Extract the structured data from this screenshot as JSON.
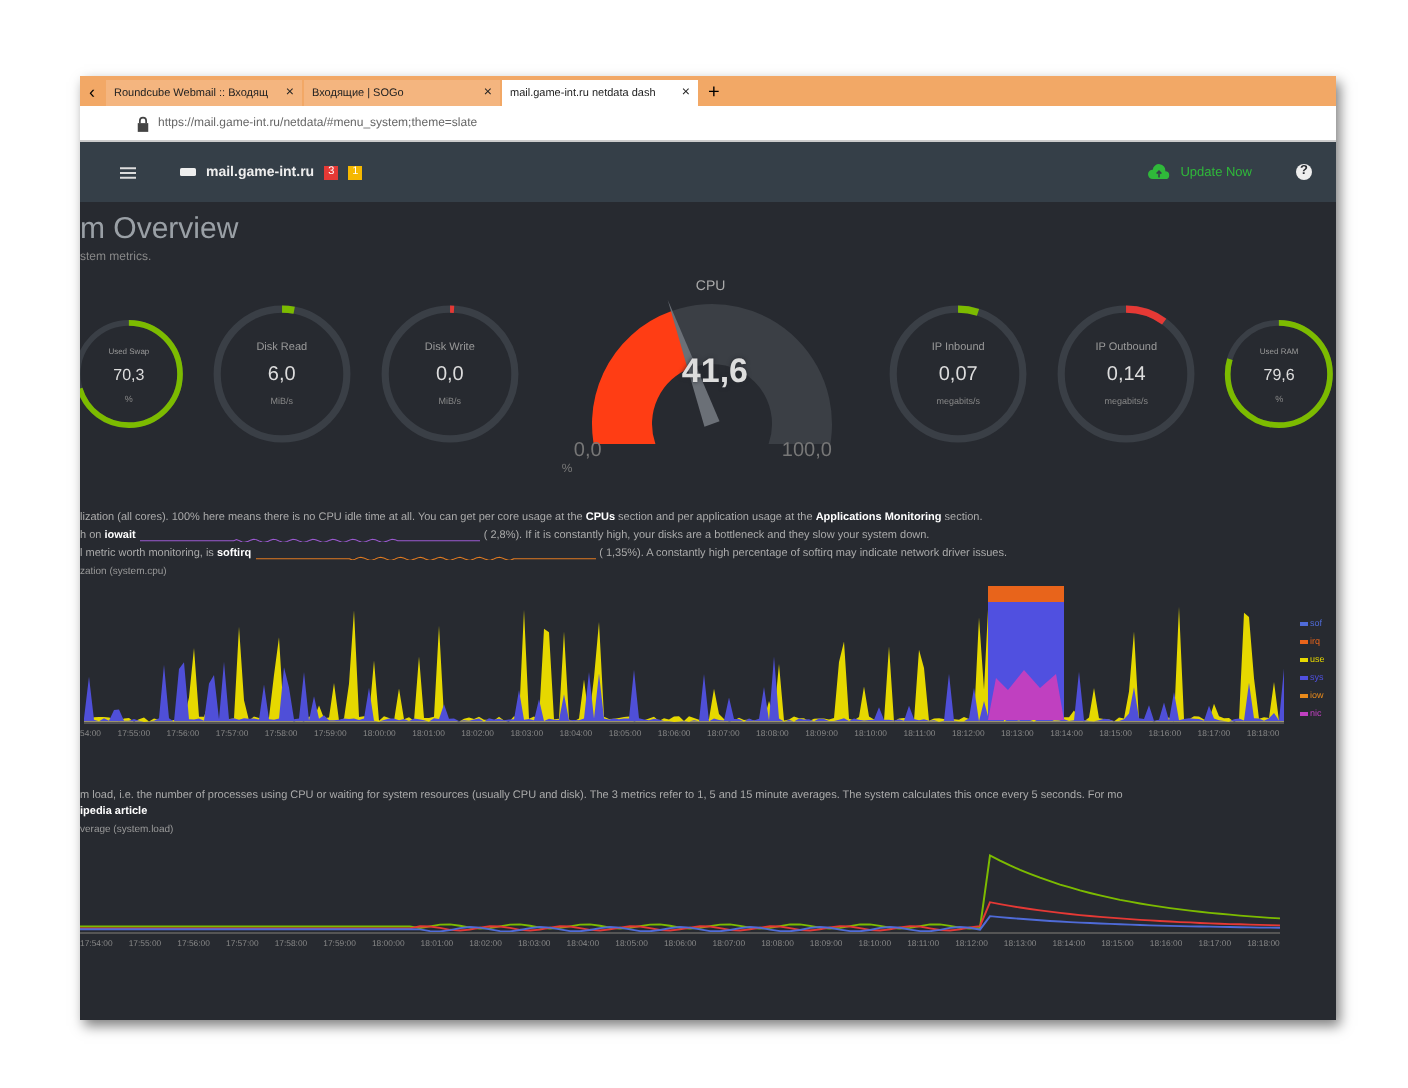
{
  "browser": {
    "scroll_left": "‹",
    "new_tab": "+",
    "tabs": [
      {
        "title": "Roundcube Webmail :: Входящ",
        "close": "×",
        "selected": false
      },
      {
        "title": "Входящие | SOGo",
        "close": "×",
        "selected": false
      },
      {
        "title": "mail.game-int.ru netdata dash",
        "close": "×",
        "selected": true
      }
    ],
    "url": "https://mail.game-int.ru/netdata/#menu_system;theme=slate"
  },
  "header": {
    "hostname": "mail.game-int.ru",
    "alarms": [
      {
        "count": "3",
        "color": "#e53935"
      },
      {
        "count": "1",
        "color": "#f5b800"
      }
    ],
    "update": "Update Now",
    "help": "?"
  },
  "page": {
    "title": "m Overview",
    "subtitle": "stem metrics."
  },
  "gauges": [
    {
      "kind": "minipie",
      "label": "Used Swap",
      "value": "70,3",
      "unit": "%",
      "level": 0.703,
      "color": "#7cbb00"
    },
    {
      "kind": "pie",
      "label": "Disk Read",
      "value": "6,0",
      "unit": "MiB/s",
      "level": 0.03,
      "color": "#7cbb00"
    },
    {
      "kind": "pie",
      "label": "Disk Write",
      "value": "0,0",
      "unit": "MiB/s",
      "level": 0.01,
      "color": "#e53935"
    },
    {
      "kind": "cpu",
      "label": "CPU",
      "value": "41,6",
      "unit": "%",
      "level": 0.416,
      "min": "0,0",
      "max": "100,0"
    },
    {
      "kind": "pie",
      "label": "IP Inbound",
      "value": "0,07",
      "unit": "megabits/s",
      "level": 0.05,
      "color": "#7cbb00"
    },
    {
      "kind": "pie",
      "label": "IP Outbound",
      "value": "0,14",
      "unit": "megabits/s",
      "level": 0.1,
      "color": "#e53935"
    },
    {
      "kind": "minipie",
      "label": "Used RAM",
      "value": "79,6",
      "unit": "%",
      "level": 0.796,
      "color": "#7cbb00"
    }
  ],
  "cpu_section": {
    "intro": "lization (all cores). 100% here means there is no CPU idle time at all. You can get per core usage at the **CPUs** section and per application usage at the **Applications Monitoring** section.",
    "lines": [
      {
        "lead": "h on **iowait**",
        "tail": "(     2,8%). If it is constantly high, your disks are a bottleneck and they slow your system down."
      },
      {
        "lead": "l metric worth monitoring, is **softirq**",
        "tail": "(     1,35%). A constantly high percentage of softirq may indicate network driver issues."
      }
    ],
    "chart_title": "zation (system.cpu)",
    "times": [
      "54:00",
      "17:55:00",
      "17:56:00",
      "17:57:00",
      "17:58:00",
      "17:59:00",
      "18:00:00",
      "18:01:00",
      "18:02:00",
      "18:03:00",
      "18:04:00",
      "18:05:00",
      "18:06:00",
      "18:07:00",
      "18:08:00",
      "18:09:00",
      "18:10:00",
      "18:11:00",
      "18:12:00",
      "18:13:00",
      "18:14:00",
      "18:15:00",
      "18:16:00",
      "18:17:00",
      "18:18:00"
    ],
    "legend": [
      {
        "name": "sof",
        "color": "#4f6bd8"
      },
      {
        "name": "irq",
        "color": "#e8641b"
      },
      {
        "name": "use",
        "color": "#e6d800"
      },
      {
        "name": "sys",
        "color": "#5050e0"
      },
      {
        "name": "iow",
        "color": "#e88a1b"
      },
      {
        "name": "nic",
        "color": "#c040c0"
      }
    ]
  },
  "load_section": {
    "text": "m load, i.e. the number of processes using CPU or waiting for system resources (usually CPU and disk). The 3 metrics refer to 1, 5 and 15 minute averages. The system calculates this once every 5 seconds. For mo",
    "link": "ipedia article",
    "chart_title": "verage (system.load)",
    "times": [
      "17:54:00",
      "17:55:00",
      "17:56:00",
      "17:57:00",
      "17:58:00",
      "17:59:00",
      "18:00:00",
      "18:01:00",
      "18:02:00",
      "18:03:00",
      "18:04:00",
      "18:05:00",
      "18:06:00",
      "18:07:00",
      "18:08:00",
      "18:09:00",
      "18:10:00",
      "18:11:00",
      "18:12:00",
      "18:13:00",
      "18:14:00",
      "18:15:00",
      "18:16:00",
      "18:17:00",
      "18:18:00"
    ]
  }
}
